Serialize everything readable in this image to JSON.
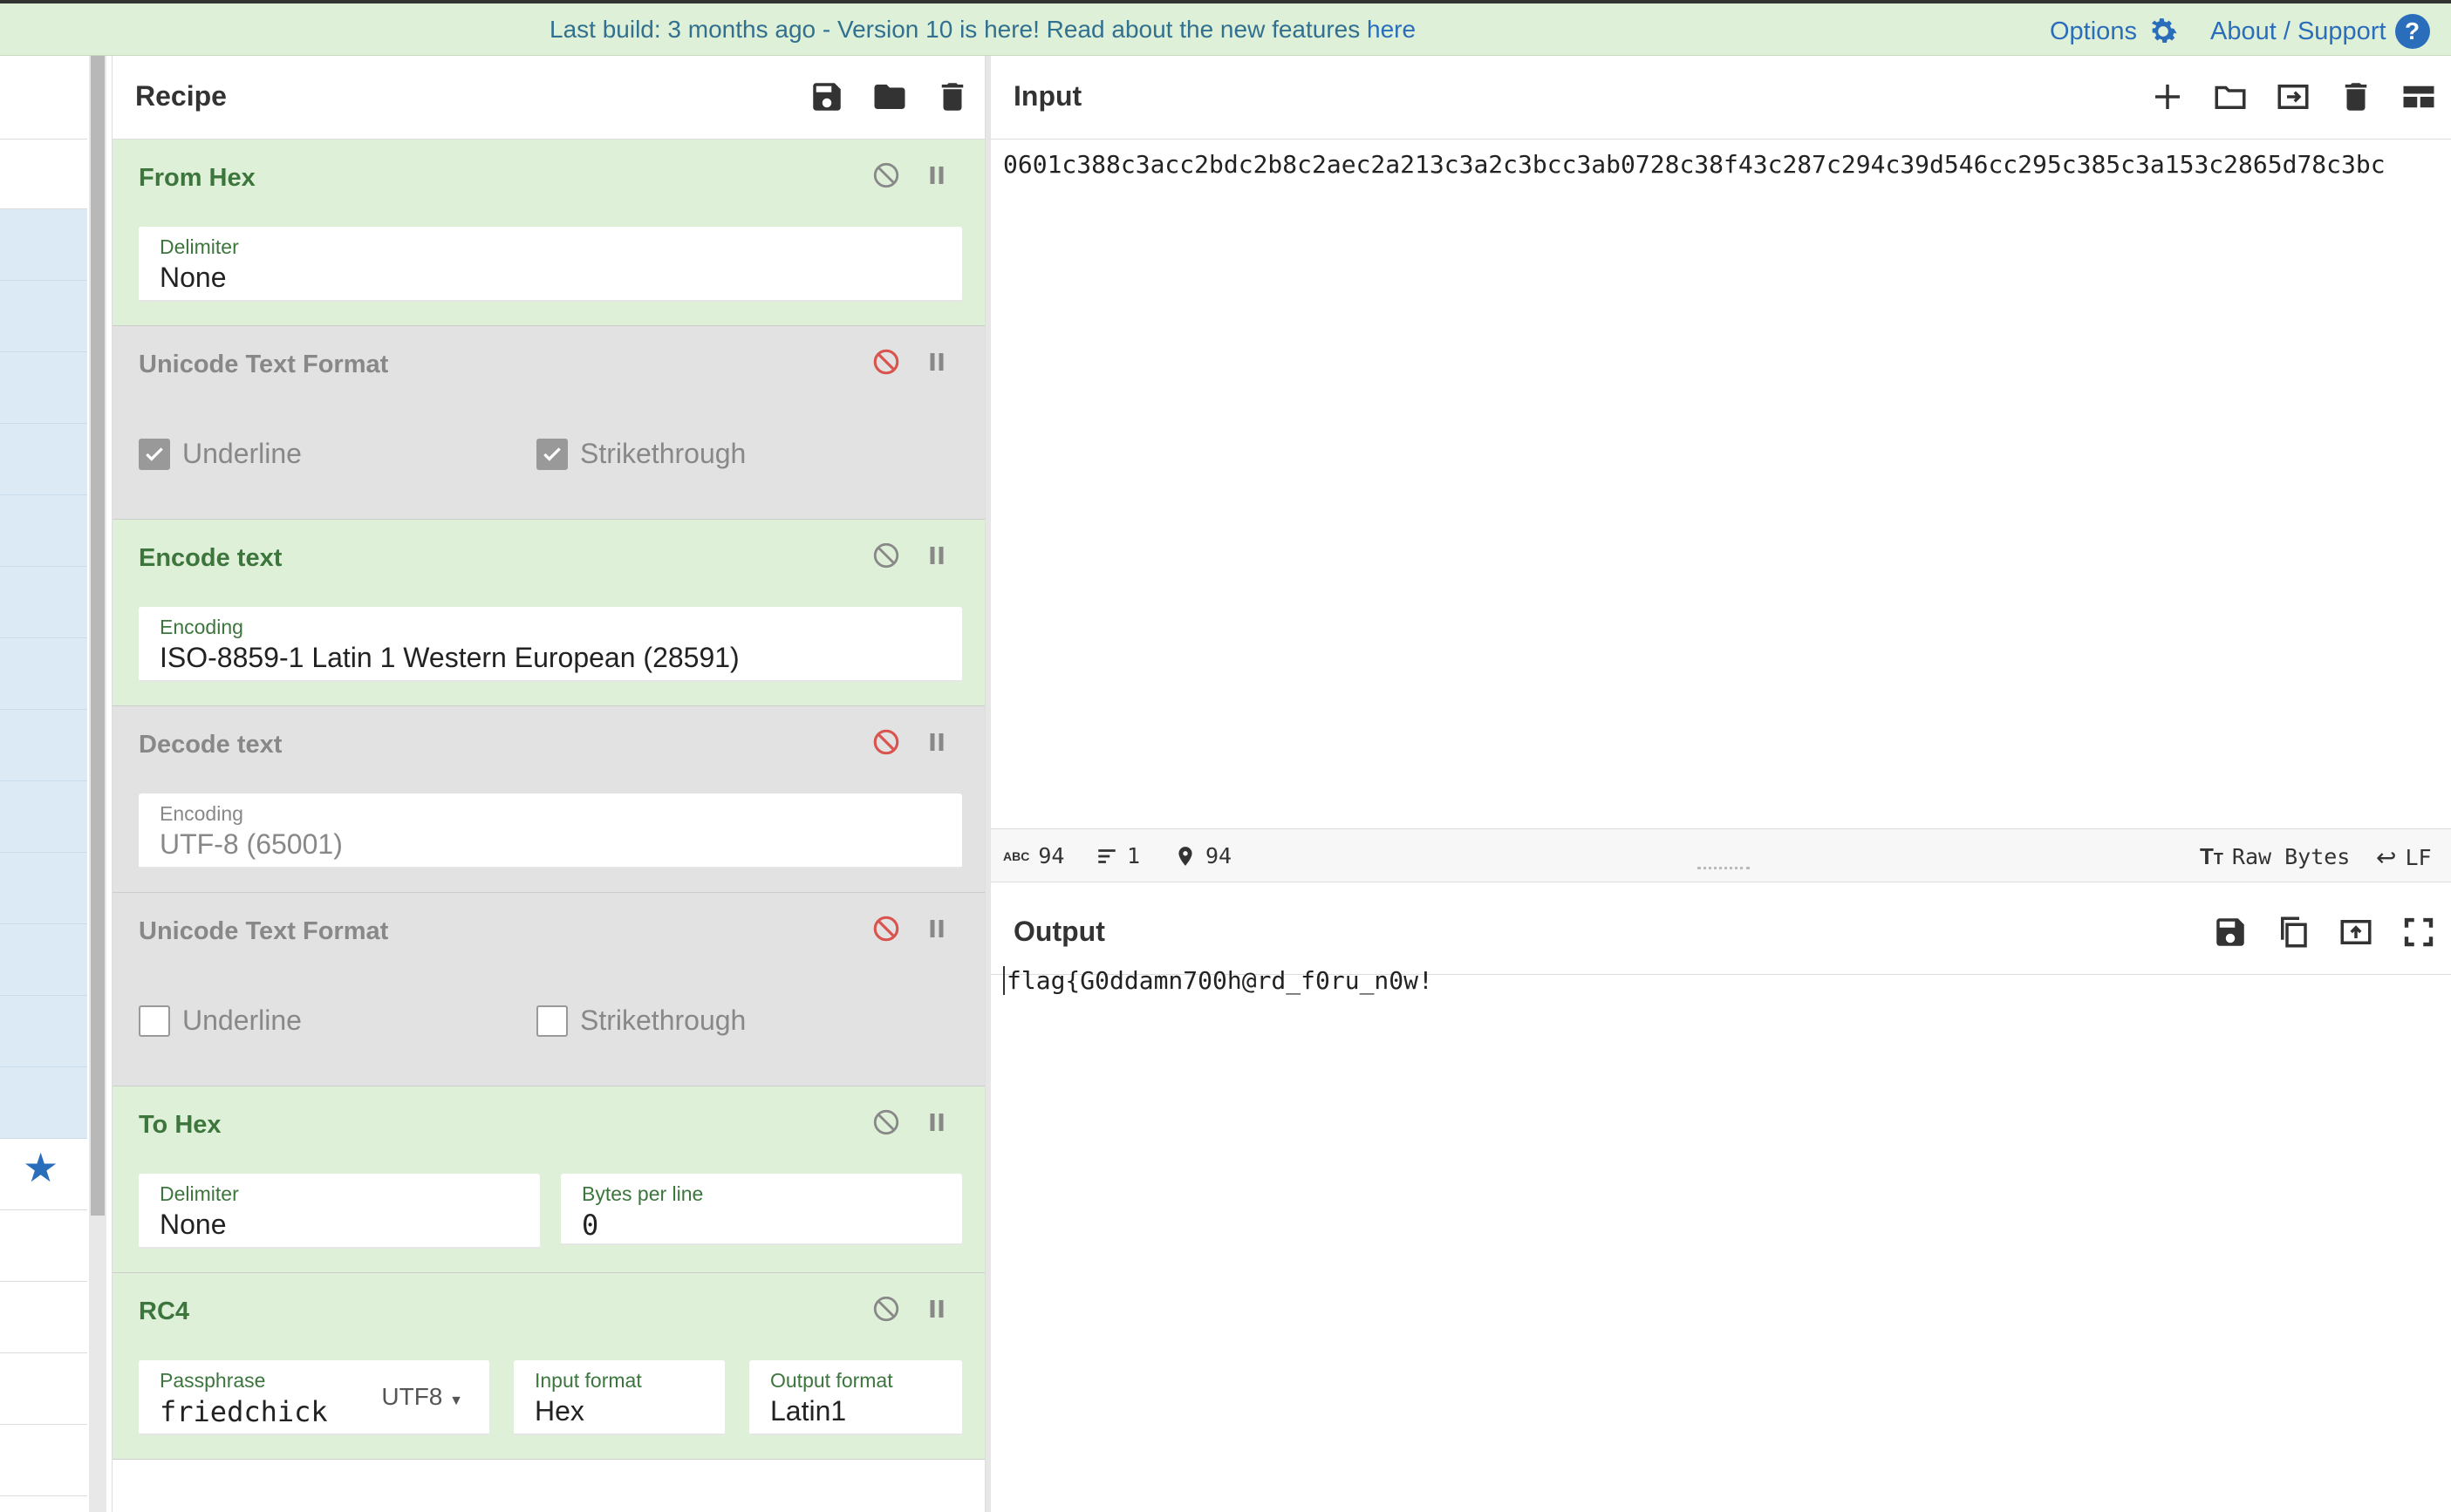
{
  "banner": {
    "message_pre": "Last build: 3 months ago - Version 10 is here! Read about the new features ",
    "message_link": "here",
    "options_label": "Options",
    "about_label": "About / Support",
    "about_icon": "?"
  },
  "recipe": {
    "title": "Recipe",
    "operations": [
      {
        "name": "From Hex",
        "enabled": true,
        "fields": [
          {
            "label": "Delimiter",
            "value": "None"
          }
        ]
      },
      {
        "name": "Unicode Text Format",
        "enabled": false,
        "checkboxes": [
          {
            "label": "Underline",
            "checked": true
          },
          {
            "label": "Strikethrough",
            "checked": true
          }
        ]
      },
      {
        "name": "Encode text",
        "enabled": true,
        "fields": [
          {
            "label": "Encoding",
            "value": "ISO-8859-1 Latin 1 Western European (28591)"
          }
        ]
      },
      {
        "name": "Decode text",
        "enabled": false,
        "fields": [
          {
            "label": "Encoding",
            "value": "UTF-8 (65001)"
          }
        ]
      },
      {
        "name": "Unicode Text Format",
        "enabled": false,
        "checkboxes": [
          {
            "label": "Underline",
            "checked": false
          },
          {
            "label": "Strikethrough",
            "checked": false
          }
        ]
      },
      {
        "name": "To Hex",
        "enabled": true,
        "fields": [
          {
            "label": "Delimiter",
            "value": "None"
          },
          {
            "label": "Bytes per line",
            "value": "0"
          }
        ]
      },
      {
        "name": "RC4",
        "enabled": true,
        "fields": [
          {
            "label": "Passphrase",
            "value": "friedchick",
            "format": "UTF8"
          },
          {
            "label": "Input format",
            "value": "Hex"
          },
          {
            "label": "Output format",
            "value": "Latin1"
          }
        ]
      }
    ]
  },
  "input": {
    "title": "Input",
    "text": "0601c388c3acc2bdc2b8c2aec2a213c3a2c3bcc3ab0728c38f43c287c294c39d546cc295c385c3a153c2865d78c3bc"
  },
  "status": {
    "chars": "94",
    "lines": "1",
    "position": "94",
    "abc_icon_label": "ABC",
    "format_label": "Raw Bytes",
    "eol_label": "LF"
  },
  "output": {
    "title": "Output",
    "text": "flag{G0ddamn700h@rd_f0ru_n0w!"
  },
  "colors": {
    "banner_bg": "#dff0d8",
    "link": "#2a6ebb",
    "enabled_op_bg": "#dff0d8",
    "disabled_op_bg": "#e2e2e2",
    "enabled_title": "#3c763d",
    "disable_icon_red": "#d9534f"
  }
}
